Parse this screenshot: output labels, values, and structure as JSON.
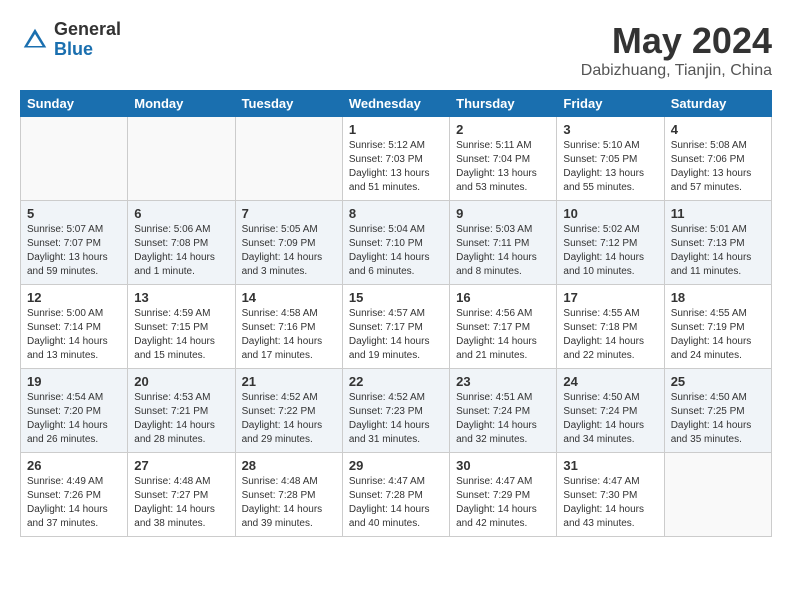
{
  "header": {
    "logo_general": "General",
    "logo_blue": "Blue",
    "month": "May 2024",
    "location": "Dabizhuang, Tianjin, China"
  },
  "weekdays": [
    "Sunday",
    "Monday",
    "Tuesday",
    "Wednesday",
    "Thursday",
    "Friday",
    "Saturday"
  ],
  "weeks": [
    [
      {
        "day": "",
        "info": ""
      },
      {
        "day": "",
        "info": ""
      },
      {
        "day": "",
        "info": ""
      },
      {
        "day": "1",
        "info": "Sunrise: 5:12 AM\nSunset: 7:03 PM\nDaylight: 13 hours\nand 51 minutes."
      },
      {
        "day": "2",
        "info": "Sunrise: 5:11 AM\nSunset: 7:04 PM\nDaylight: 13 hours\nand 53 minutes."
      },
      {
        "day": "3",
        "info": "Sunrise: 5:10 AM\nSunset: 7:05 PM\nDaylight: 13 hours\nand 55 minutes."
      },
      {
        "day": "4",
        "info": "Sunrise: 5:08 AM\nSunset: 7:06 PM\nDaylight: 13 hours\nand 57 minutes."
      }
    ],
    [
      {
        "day": "5",
        "info": "Sunrise: 5:07 AM\nSunset: 7:07 PM\nDaylight: 13 hours\nand 59 minutes."
      },
      {
        "day": "6",
        "info": "Sunrise: 5:06 AM\nSunset: 7:08 PM\nDaylight: 14 hours\nand 1 minute."
      },
      {
        "day": "7",
        "info": "Sunrise: 5:05 AM\nSunset: 7:09 PM\nDaylight: 14 hours\nand 3 minutes."
      },
      {
        "day": "8",
        "info": "Sunrise: 5:04 AM\nSunset: 7:10 PM\nDaylight: 14 hours\nand 6 minutes."
      },
      {
        "day": "9",
        "info": "Sunrise: 5:03 AM\nSunset: 7:11 PM\nDaylight: 14 hours\nand 8 minutes."
      },
      {
        "day": "10",
        "info": "Sunrise: 5:02 AM\nSunset: 7:12 PM\nDaylight: 14 hours\nand 10 minutes."
      },
      {
        "day": "11",
        "info": "Sunrise: 5:01 AM\nSunset: 7:13 PM\nDaylight: 14 hours\nand 11 minutes."
      }
    ],
    [
      {
        "day": "12",
        "info": "Sunrise: 5:00 AM\nSunset: 7:14 PM\nDaylight: 14 hours\nand 13 minutes."
      },
      {
        "day": "13",
        "info": "Sunrise: 4:59 AM\nSunset: 7:15 PM\nDaylight: 14 hours\nand 15 minutes."
      },
      {
        "day": "14",
        "info": "Sunrise: 4:58 AM\nSunset: 7:16 PM\nDaylight: 14 hours\nand 17 minutes."
      },
      {
        "day": "15",
        "info": "Sunrise: 4:57 AM\nSunset: 7:17 PM\nDaylight: 14 hours\nand 19 minutes."
      },
      {
        "day": "16",
        "info": "Sunrise: 4:56 AM\nSunset: 7:17 PM\nDaylight: 14 hours\nand 21 minutes."
      },
      {
        "day": "17",
        "info": "Sunrise: 4:55 AM\nSunset: 7:18 PM\nDaylight: 14 hours\nand 22 minutes."
      },
      {
        "day": "18",
        "info": "Sunrise: 4:55 AM\nSunset: 7:19 PM\nDaylight: 14 hours\nand 24 minutes."
      }
    ],
    [
      {
        "day": "19",
        "info": "Sunrise: 4:54 AM\nSunset: 7:20 PM\nDaylight: 14 hours\nand 26 minutes."
      },
      {
        "day": "20",
        "info": "Sunrise: 4:53 AM\nSunset: 7:21 PM\nDaylight: 14 hours\nand 28 minutes."
      },
      {
        "day": "21",
        "info": "Sunrise: 4:52 AM\nSunset: 7:22 PM\nDaylight: 14 hours\nand 29 minutes."
      },
      {
        "day": "22",
        "info": "Sunrise: 4:52 AM\nSunset: 7:23 PM\nDaylight: 14 hours\nand 31 minutes."
      },
      {
        "day": "23",
        "info": "Sunrise: 4:51 AM\nSunset: 7:24 PM\nDaylight: 14 hours\nand 32 minutes."
      },
      {
        "day": "24",
        "info": "Sunrise: 4:50 AM\nSunset: 7:24 PM\nDaylight: 14 hours\nand 34 minutes."
      },
      {
        "day": "25",
        "info": "Sunrise: 4:50 AM\nSunset: 7:25 PM\nDaylight: 14 hours\nand 35 minutes."
      }
    ],
    [
      {
        "day": "26",
        "info": "Sunrise: 4:49 AM\nSunset: 7:26 PM\nDaylight: 14 hours\nand 37 minutes."
      },
      {
        "day": "27",
        "info": "Sunrise: 4:48 AM\nSunset: 7:27 PM\nDaylight: 14 hours\nand 38 minutes."
      },
      {
        "day": "28",
        "info": "Sunrise: 4:48 AM\nSunset: 7:28 PM\nDaylight: 14 hours\nand 39 minutes."
      },
      {
        "day": "29",
        "info": "Sunrise: 4:47 AM\nSunset: 7:28 PM\nDaylight: 14 hours\nand 40 minutes."
      },
      {
        "day": "30",
        "info": "Sunrise: 4:47 AM\nSunset: 7:29 PM\nDaylight: 14 hours\nand 42 minutes."
      },
      {
        "day": "31",
        "info": "Sunrise: 4:47 AM\nSunset: 7:30 PM\nDaylight: 14 hours\nand 43 minutes."
      },
      {
        "day": "",
        "info": ""
      }
    ]
  ]
}
